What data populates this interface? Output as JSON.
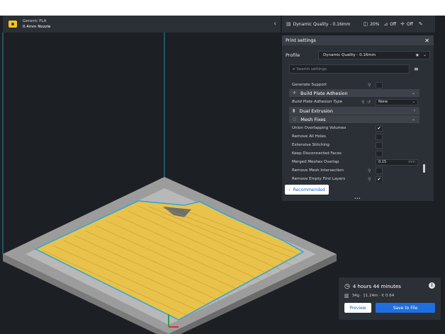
{
  "material": {
    "name": "Generic PLA",
    "nozzle": "0.4mm Nozzle"
  },
  "quality_bar": {
    "profile": "Dynamic Quality - 0.16mm",
    "infill": "20%",
    "support": "Off",
    "adhesion": "Off"
  },
  "print_settings": {
    "title": "Print settings",
    "profile_label": "Profile",
    "profile_value": "Dynamic Quality - 0.16mm",
    "search_placeholder": "Search settings",
    "rows": {
      "generate_support": "Generate Support",
      "build_plate_adhesion": "Build Plate Adhesion",
      "build_plate_adhesion_type": "Build Plate Adhesion Type",
      "build_plate_adhesion_type_value": "None",
      "dual_extrusion": "Dual Extrusion",
      "mesh_fixes": "Mesh Fixes",
      "union_overlapping_volumes": "Union Overlapping Volumes",
      "remove_all_holes": "Remove All Holes",
      "extensive_stitching": "Extensive Stitching",
      "keep_disconnected_faces": "Keep Disconnected Faces",
      "merged_meshes_overlap": "Merged Meshes Overlap",
      "merged_meshes_overlap_value": "0.15",
      "merged_meshes_overlap_unit": "mm",
      "remove_mesh_intersection": "Remove Mesh Intersection",
      "remove_empty_first_layers": "Remove Empty First Layers"
    },
    "recommended_button": "Recommended"
  },
  "estimate": {
    "time": "4 hours 44 minutes",
    "material": "34g · 11.24m · € 0.64",
    "preview_button": "Preview",
    "save_button": "Save to File"
  },
  "colors": {
    "accent": "#1f6fe0",
    "panel": "#2b2f36",
    "model_fill": "#e8c24a",
    "model_outline": "#35a7d8",
    "build_volume": "#2fa6c9"
  }
}
